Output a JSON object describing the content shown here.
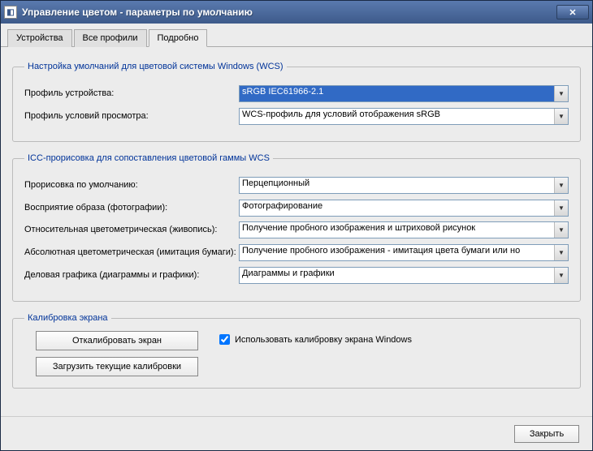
{
  "titlebar": {
    "title": "Управление цветом - параметры по умолчанию"
  },
  "tabs": {
    "t0": "Устройства",
    "t1": "Все профили",
    "t2": "Подробно"
  },
  "group_wcs": {
    "legend": "Настройка умолчаний для цветовой системы Windows (WCS)",
    "device_label": "Профиль устройства:",
    "device_value": "sRGB IEC61966-2.1",
    "viewing_label": "Профиль условий просмотра:",
    "viewing_value": "WCS-профиль для условий отображения sRGB"
  },
  "group_icc": {
    "legend": "ICC-прорисовка для сопоставления цветовой гаммы WCS",
    "default_label": "Прорисовка по умолчанию:",
    "default_value": "Перцепционный",
    "perceptual_label": "Восприятие образа (фотографии):",
    "perceptual_value": "Фотографирование",
    "relcol_label": "Относительная цветометрическая (живопись):",
    "relcol_value": "Получение пробного изображения и штриховой рисунок",
    "abscol_label": "Абсолютная цветометрическая (имитация бумаги):",
    "abscol_value": "Получение пробного изображения - имитация цвета бумаги или но",
    "business_label": "Деловая графика (диаграммы и графики):",
    "business_value": "Диаграммы и графики"
  },
  "group_calib": {
    "legend": "Калибровка экрана",
    "btn_calibrate": "Откалибровать экран",
    "btn_load": "Загрузить текущие калибровки",
    "chk_label": "Использовать калибровку экрана Windows"
  },
  "footer": {
    "close": "Закрыть"
  }
}
